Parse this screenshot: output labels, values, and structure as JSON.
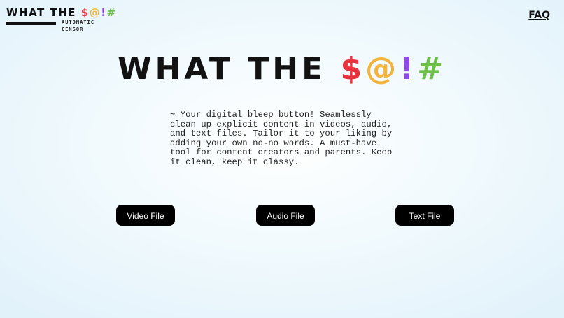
{
  "logo": {
    "title_text": "WHAT THE ",
    "symbols": [
      "$",
      "@",
      "!",
      "#"
    ],
    "subtitle_line1": "AUTOMATIC",
    "subtitle_line2": "CENSOR"
  },
  "nav": {
    "faq_label": "FAQ"
  },
  "hero": {
    "title_text": "WHAT THE ",
    "symbols": [
      "$",
      "@",
      "!",
      "#"
    ]
  },
  "description": "~ Your digital bleep button! Seamlessly clean up explicit content in videos, audio, and text files. Tailor it to your liking by adding your own no-no words. A must-have tool for content creators and parents. Keep it clean, keep it classy.",
  "buttons": {
    "video": "Video File",
    "audio": "Audio File",
    "text": "Text File"
  },
  "colors": {
    "symbol_dollar": "#e8323d",
    "symbol_at": "#f4b33b",
    "symbol_exclaim": "#8f49e6",
    "symbol_hash": "#6cc04a",
    "button_bg": "#000000",
    "button_text": "#ffffff"
  }
}
